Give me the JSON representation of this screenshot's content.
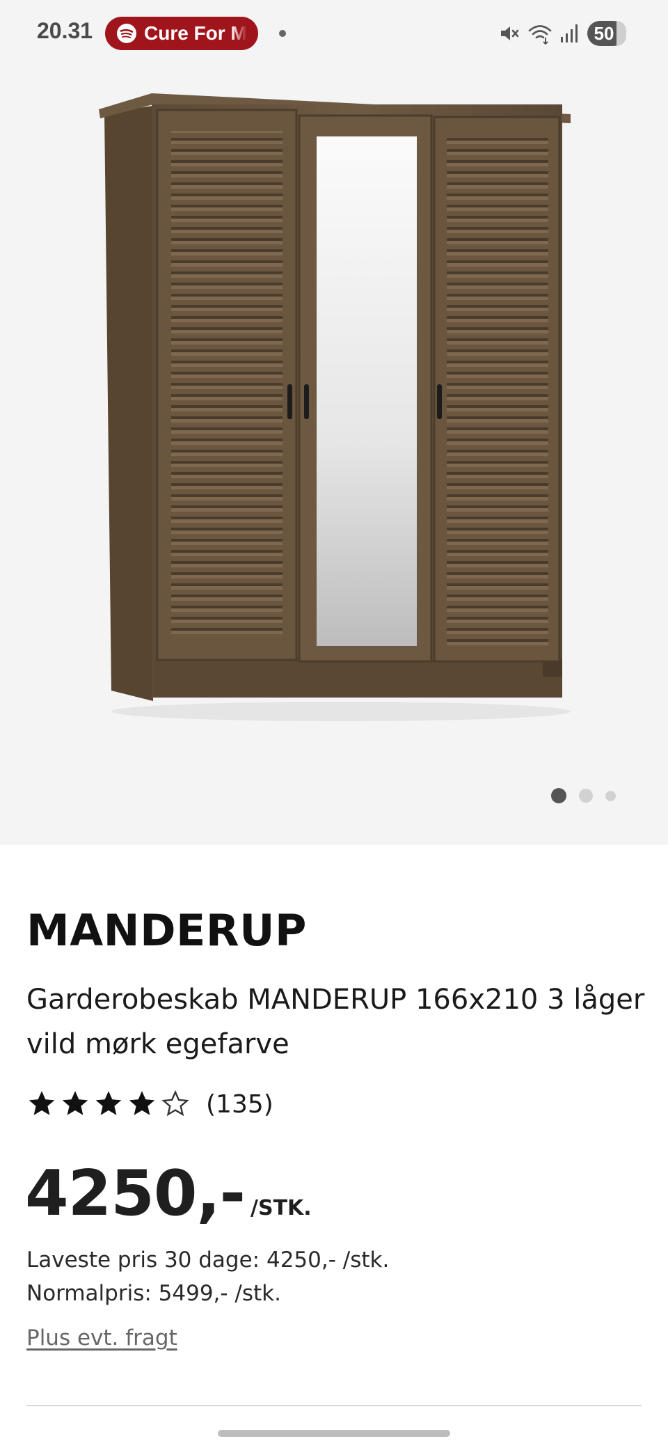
{
  "status_bar": {
    "time": "20.31",
    "media_title": "Cure For Me",
    "battery_level": "50",
    "icons": [
      "spotify-icon",
      "mute-icon",
      "wifi-icon",
      "signal-icon",
      "battery-icon"
    ]
  },
  "gallery": {
    "image_alt": "Garderobeskab MANDERUP",
    "page_count": 3,
    "active_page": 1
  },
  "product": {
    "brand": "MANDERUP",
    "name": "Garderobeskab MANDERUP 166x210 3 låger vild mørk egefarve",
    "rating": 4,
    "rating_max": 5,
    "review_count": "(135)",
    "price": "4250,-",
    "price_unit": "/STK.",
    "lowest_price_30_days": "Laveste pris 30 dage: 4250,- /stk.",
    "normal_price": "Normalpris: 5499,- /stk.",
    "shipping_link": "Plus evt. fragt"
  },
  "colors": {
    "media_pill": "#a0141c",
    "image_background": "#f4f4f4",
    "text_primary": "#111111",
    "link": "#666666"
  }
}
